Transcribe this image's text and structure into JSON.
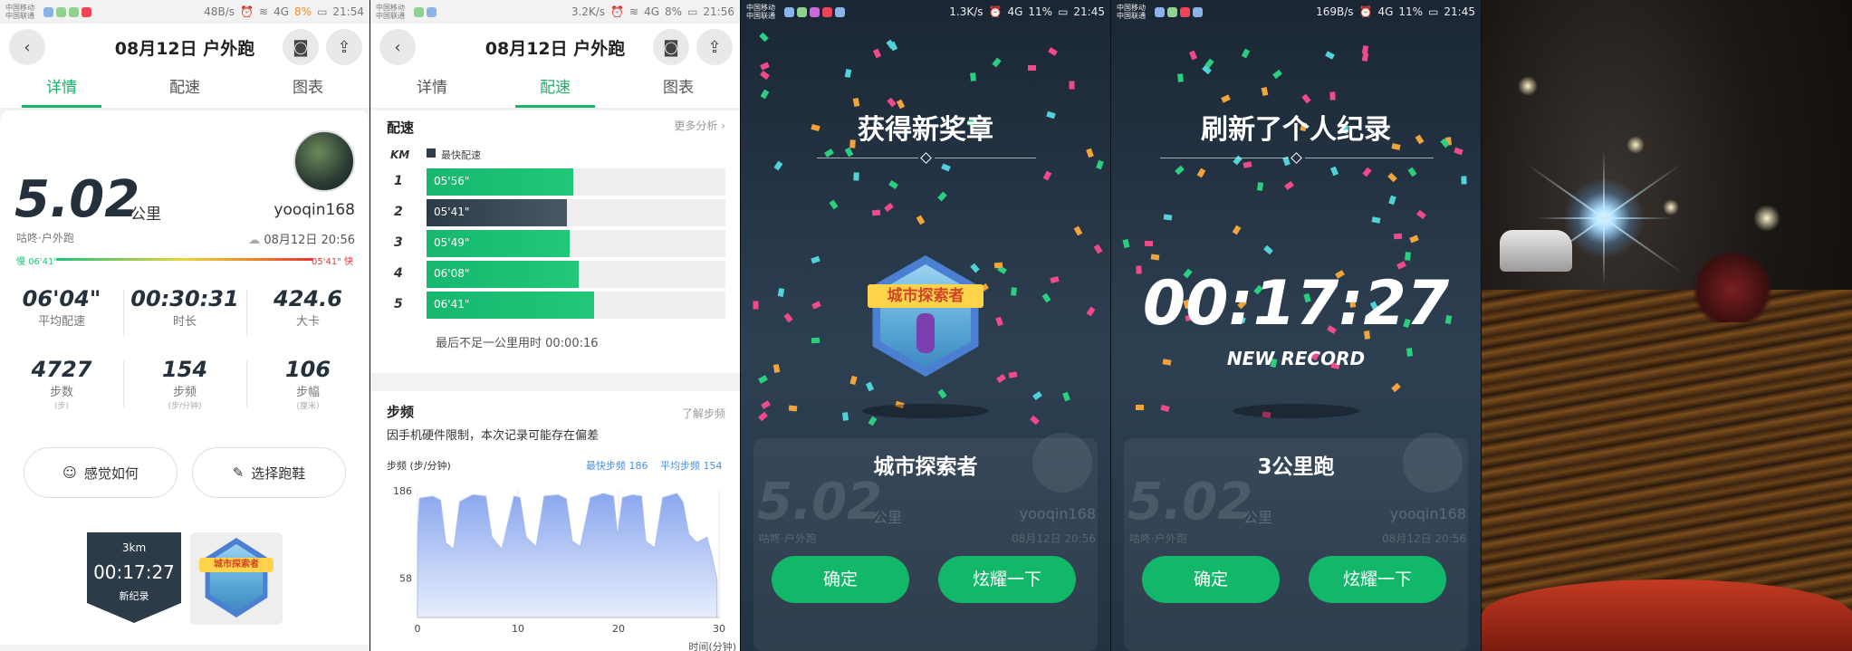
{
  "status1": {
    "carrier": "中国移动\n中国联通",
    "speed": "48B/s",
    "net": "4G",
    "battery": "8%",
    "time": "21:54"
  },
  "status2": {
    "carrier": "中国移动\n中国联通",
    "speed": "3.2K/s",
    "net": "4G",
    "battery": "8%",
    "time": "21:56"
  },
  "status3": {
    "carrier": "中国移动\n中国联通",
    "speed": "1.3K/s",
    "net": "4G",
    "battery": "11%",
    "time": "21:45"
  },
  "status4": {
    "carrier": "中国移动\n中国联通",
    "speed": "169B/s",
    "net": "4G",
    "battery": "11%",
    "time": "21:45"
  },
  "header": {
    "title": "08月12日 户外跑",
    "back_icon": "back-icon",
    "camera_icon": "camera-icon",
    "share_icon": "share-icon"
  },
  "tabs": [
    {
      "label": "详情"
    },
    {
      "label": "配速"
    },
    {
      "label": "图表"
    }
  ],
  "details": {
    "distance": "5.02",
    "distance_unit": "公里",
    "username": "yooqin168",
    "sport": "咕咚·户外跑",
    "date": "08月12日 20:56",
    "slow_label": "慢 06'41\"",
    "fast_label": "05'41\" 快",
    "stats": [
      {
        "value": "06'04\"",
        "label": "平均配速",
        "sub": ""
      },
      {
        "value": "00:30:31",
        "label": "时长",
        "sub": ""
      },
      {
        "value": "424.6",
        "label": "大卡",
        "sub": ""
      },
      {
        "value": "4727",
        "label": "步数",
        "sub": "(步)"
      },
      {
        "value": "154",
        "label": "步频",
        "sub": "(步/分钟)"
      },
      {
        "value": "106",
        "label": "步幅",
        "sub": "(厘米)"
      }
    ],
    "feel_button": "感觉如何",
    "shoe_button": "选择跑鞋",
    "record_medal": {
      "km": "3km",
      "time": "00:17:27",
      "label": "新纪录"
    },
    "badge_text": "城市探索者"
  },
  "pace": {
    "title": "配速",
    "more": "更多分析 ›",
    "km_header": "KM",
    "legend": "最快配速",
    "rows": [
      {
        "km": "1",
        "pace": "05'56\"",
        "ratio": 0.49,
        "fastest": false
      },
      {
        "km": "2",
        "pace": "05'41\"",
        "ratio": 0.47,
        "fastest": true
      },
      {
        "km": "3",
        "pace": "05'49\"",
        "ratio": 0.48,
        "fastest": false
      },
      {
        "km": "4",
        "pace": "06'08\"",
        "ratio": 0.51,
        "fastest": false
      },
      {
        "km": "5",
        "pace": "06'41\"",
        "ratio": 0.56,
        "fastest": false
      }
    ],
    "note": "最后不足一公里用时 00:00:16"
  },
  "cadence": {
    "title": "步频",
    "more": "了解步频",
    "warning": "因手机硬件限制，本次记录可能存在偏差",
    "ylabel": "步频 (步/分钟)",
    "fastest": "最快步频 186",
    "average": "平均步频 154",
    "xlabel": "时间(分钟)"
  },
  "chart_data": {
    "type": "area",
    "title": "",
    "xlabel": "时间(分钟)",
    "ylabel": "步频 (步/分钟)",
    "xlim": [
      0,
      30
    ],
    "x_ticks": [
      0,
      10,
      20,
      30
    ],
    "y_ticks": [
      58,
      186
    ],
    "series": [
      {
        "values": [
          [
            0,
            120
          ],
          [
            0.2,
            175
          ],
          [
            1.5,
            178
          ],
          [
            2.3,
            172
          ],
          [
            2.8,
            110
          ],
          [
            3.6,
            100
          ],
          [
            4.2,
            170
          ],
          [
            5.5,
            180
          ],
          [
            6.8,
            178
          ],
          [
            7.4,
            118
          ],
          [
            8.4,
            100
          ],
          [
            9.6,
            178
          ],
          [
            10.2,
            176
          ],
          [
            10.8,
            118
          ],
          [
            11.8,
            104
          ],
          [
            12.6,
            178
          ],
          [
            14.0,
            180
          ],
          [
            14.8,
            174
          ],
          [
            15.4,
            112
          ],
          [
            16.2,
            104
          ],
          [
            17.2,
            176
          ],
          [
            18.5,
            182
          ],
          [
            19.5,
            178
          ],
          [
            19.9,
            120
          ],
          [
            20.4,
            176
          ],
          [
            21.4,
            180
          ],
          [
            22.3,
            178
          ],
          [
            22.7,
            112
          ],
          [
            23.6,
            102
          ],
          [
            24.4,
            176
          ],
          [
            25.8,
            182
          ],
          [
            26.4,
            170
          ],
          [
            27.0,
            122
          ],
          [
            27.8,
            110
          ],
          [
            28.8,
            118
          ],
          [
            29.3,
            90
          ],
          [
            29.8,
            55
          ]
        ]
      }
    ]
  },
  "medal_popup": {
    "title": "获得新奖章",
    "badge_text": "城市探索者",
    "name": "城市探索者",
    "confirm": "确定",
    "show_off": "炫耀一下"
  },
  "record_popup": {
    "title": "刷新了个人纪录",
    "time": "00:17:27",
    "subtitle": "NEW RECORD",
    "name": "3公里跑",
    "confirm": "确定",
    "show_off": "炫耀一下"
  },
  "colors": {
    "accent": "#19b36b",
    "dark": "#2d3b48",
    "popup_bg": "#263646"
  }
}
